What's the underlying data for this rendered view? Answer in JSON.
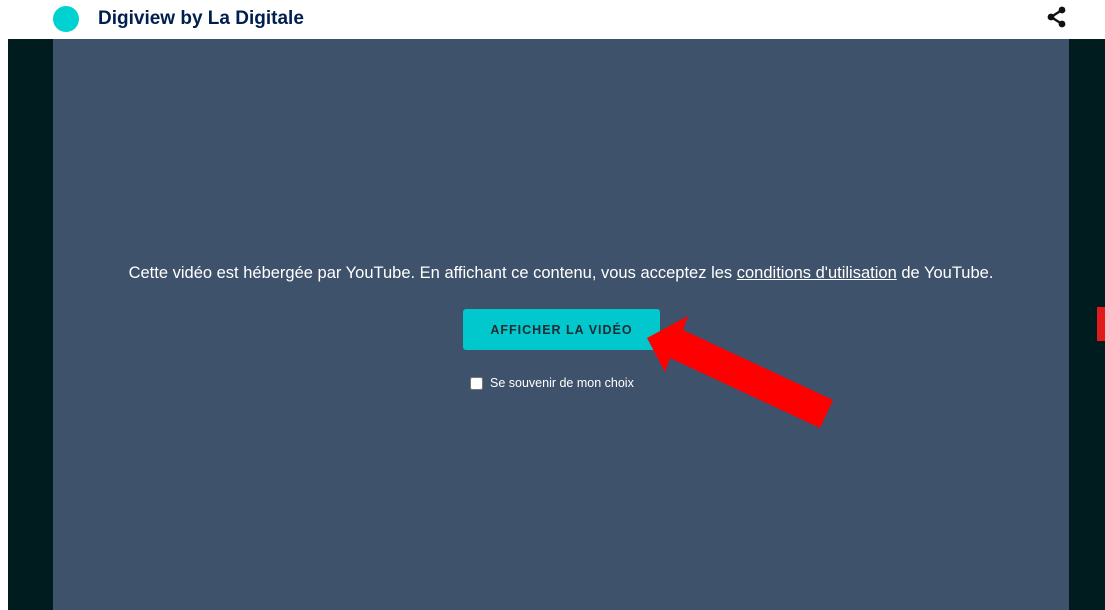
{
  "header": {
    "app_title": "Digiview by La Digitale",
    "logo_color": "#00d1d1",
    "share_icon": "share-icon"
  },
  "player": {
    "notice_before": "Cette vidéo est hébergée par YouTube. En affichant ce contenu, vous acceptez les ",
    "notice_link": "conditions d'utilisation",
    "notice_after": " de YouTube.",
    "show_button_label": "AFFICHER LA VIDÉO",
    "remember_label": "Se souvenir de mon choix",
    "remember_checked": false,
    "background_color": "#3f526b",
    "accent_color": "#00c8cc"
  },
  "annotation": {
    "arrow_color": "#ff0000"
  }
}
